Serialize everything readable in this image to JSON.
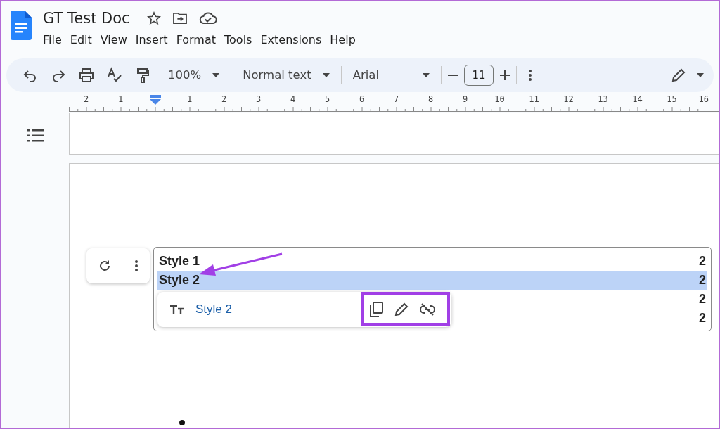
{
  "document": {
    "title": "GT Test Doc"
  },
  "menu": [
    "File",
    "Edit",
    "View",
    "Insert",
    "Format",
    "Tools",
    "Extensions",
    "Help"
  ],
  "toolbar": {
    "zoom": "100%",
    "style": "Normal text",
    "font": "Arial",
    "font_size": "11"
  },
  "ruler": {
    "left_labels": [
      "2",
      "1"
    ],
    "right_labels": [
      "1",
      "2",
      "3",
      "4",
      "5",
      "6",
      "7",
      "8",
      "9",
      "10",
      "11",
      "12",
      "13",
      "14",
      "15",
      "16"
    ]
  },
  "toc": {
    "rows": [
      {
        "title": "Style 1",
        "page": "2",
        "selected": false
      },
      {
        "title": "Style 2",
        "page": "2",
        "selected": true
      },
      {
        "page": "2",
        "selected": false
      },
      {
        "page": "2",
        "selected": false
      }
    ]
  },
  "link_popup": {
    "text": "Style 2"
  }
}
